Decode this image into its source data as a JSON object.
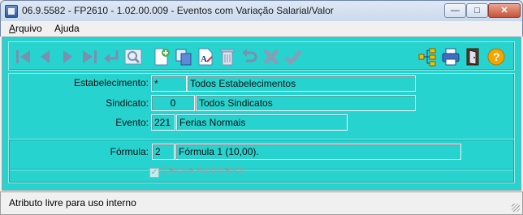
{
  "window": {
    "title": "06.9.5582 - FP2610 - 1.02.00.009 - Eventos com Variação Salarial/Valor",
    "min_label": "—",
    "max_label": "□",
    "close_label": "✕"
  },
  "menu": {
    "arquivo_u": "A",
    "arquivo_rest": "rquivo",
    "ajuda_pre": "A",
    "ajuda_u": "j",
    "ajuda_rest": "uda"
  },
  "toolbar": {
    "icons": [
      "first-icon",
      "prev-icon",
      "next-icon",
      "last-icon",
      "return-icon",
      "search-icon",
      "new-record-icon",
      "copy-icon",
      "edit-icon",
      "delete-icon",
      "undo-icon",
      "cancel-icon",
      "confirm-icon",
      "tree-icon",
      "print-icon",
      "exit-icon",
      "help-icon"
    ]
  },
  "form": {
    "estabelecimento_label": "Estabelecimento:",
    "estabelecimento_code": "*",
    "estabelecimento_desc": "Todos Estabelecimentos",
    "sindicato_label": "Sindicato:",
    "sindicato_code": "0",
    "sindicato_desc": "Todos Sindicatos",
    "evento_label": "Evento:",
    "evento_code": "221",
    "evento_desc": "Ferias Normais",
    "formula_label": "Fórmula:",
    "formula_code": "2",
    "formula_desc": "Fórmula 1 (10,00).",
    "calcula_label": "Calcula Automático",
    "calcula_checked": true
  },
  "status": {
    "text": "Atributo livre para uso interno"
  },
  "colors": {
    "background": "#26d3cf",
    "help_icon": "#f5a400"
  }
}
